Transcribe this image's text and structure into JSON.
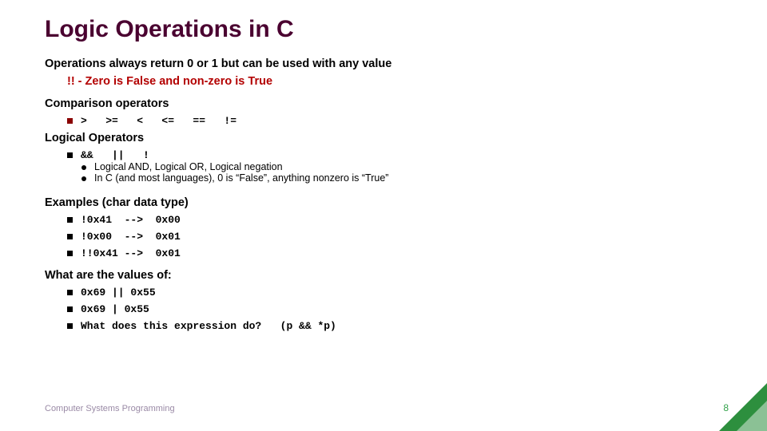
{
  "title": "Logic Operations in C",
  "intro": "Operations always return 0 or 1 but can be used with any value",
  "intro_sub": "!! -  Zero is False and non-zero is True",
  "comparison": {
    "heading": "Comparison operators",
    "ops": ">   >=   <   <=   ==   !="
  },
  "logical": {
    "heading": "Logical Operators",
    "ops": "&&   ||   !",
    "desc": [
      "Logical AND, Logical OR, Logical negation",
      "In C (and most languages), 0 is “False”, anything nonzero is “True”"
    ]
  },
  "examples": {
    "heading": "Examples (char data type)",
    "items": [
      "!0x41  -->  0x00",
      "!0x00  -->  0x01",
      "!!0x41 -->  0x01"
    ]
  },
  "values": {
    "heading": "What are the values of:",
    "items": [
      "0x69 || 0x55",
      "0x69 | 0x55",
      "What does this expression do?   (p && *p)"
    ]
  },
  "footer": "Computer Systems Programming",
  "page": "8"
}
